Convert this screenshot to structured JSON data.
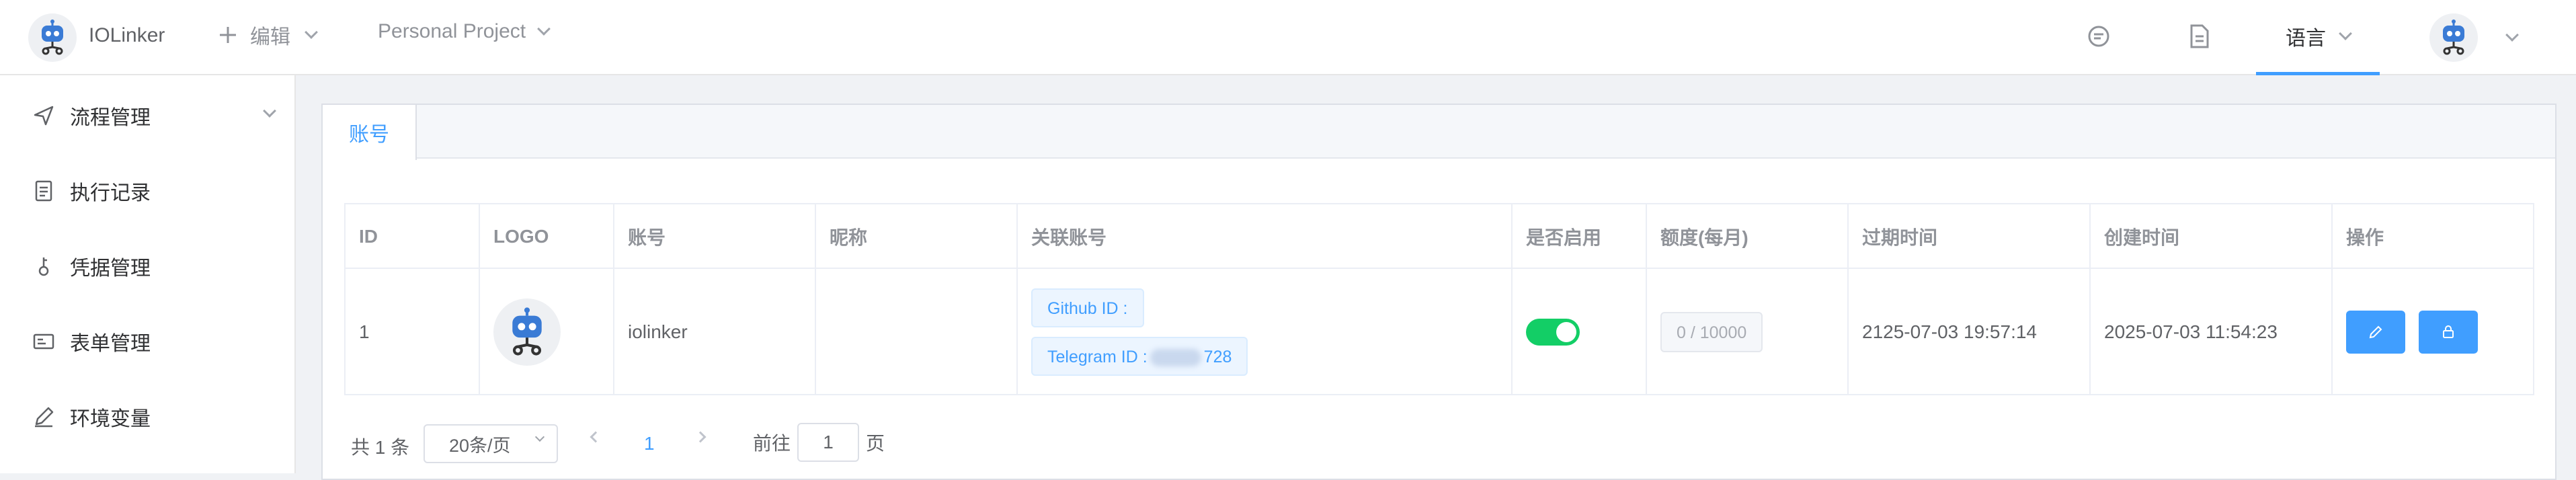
{
  "app": {
    "title": "IOLinker"
  },
  "header": {
    "edit_label": "编辑",
    "project_label": "Personal Project",
    "language_label": "语言",
    "icons": [
      "chat-icon",
      "document-icon",
      "robot-avatar"
    ]
  },
  "sidebar": {
    "items": [
      {
        "label": "流程管理",
        "icon": "send-icon"
      },
      {
        "label": "执行记录",
        "icon": "document-icon"
      },
      {
        "label": "凭据管理",
        "icon": "key-icon"
      },
      {
        "label": "表单管理",
        "icon": "form-icon"
      },
      {
        "label": "环境变量",
        "icon": "edit-icon"
      }
    ]
  },
  "tabs": [
    {
      "label": "账号",
      "active": true
    }
  ],
  "table": {
    "headers": [
      "ID",
      "LOGO",
      "账号",
      "昵称",
      "关联账号",
      "是否启用",
      "额度(每月)",
      "过期时间",
      "创建时间",
      "操作"
    ],
    "rows": [
      {
        "id": "1",
        "account": "iolinker",
        "nickname": "",
        "github": "Github ID :",
        "telegram_prefix": "Telegram ID :",
        "telegram_suffix": "728",
        "enabled": true,
        "quota": "0 / 10000",
        "expire": "2125-07-03 19:57:14",
        "created": "2025-07-03 11:54:23"
      }
    ]
  },
  "pagination": {
    "total": "共 1 条",
    "page_size": "20条/页",
    "current": "1",
    "goto_label": "前往",
    "goto_value": "1",
    "page_suffix": "页"
  },
  "colors": {
    "primary": "#409eff",
    "switch_on": "#13ce66"
  }
}
